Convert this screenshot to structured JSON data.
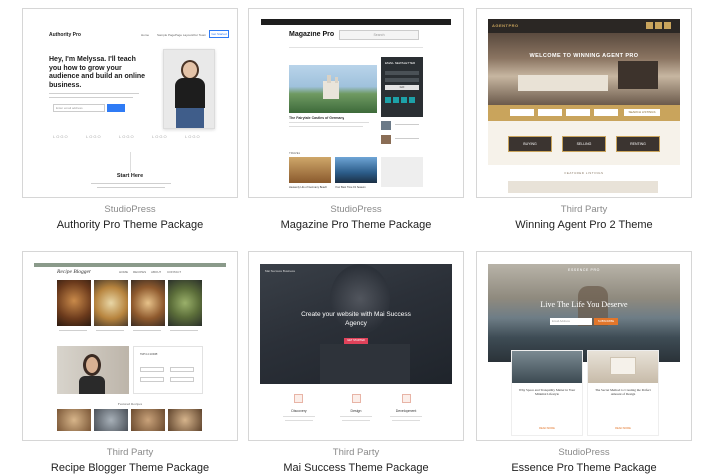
{
  "themes": [
    {
      "vendor": "StudioPress",
      "name": "Authority Pro Theme Package",
      "preview": {
        "logo": "Authority Pro",
        "nav": [
          "Home",
          "Sample Page",
          "Page Layouts",
          "Our Team"
        ],
        "nav_button": "Get Started",
        "headline": "Hey, I'm Melyssa. I'll teach you how to grow your audience and build an online business.",
        "email_placeholder": "Enter email address",
        "footer_heading": "Start Here",
        "logos": [
          "LOGO",
          "LOGO",
          "LOGO",
          "LOGO",
          "LOGO"
        ]
      }
    },
    {
      "vendor": "StudioPress",
      "name": "Magazine Pro Theme Package",
      "preview": {
        "logo": "Magazine Pro",
        "search_placeholder": "Search",
        "featured_caption": "The Fairytale Castles of Germany",
        "sidebar_heading": "EMAIL NEWSLETTER",
        "sidebar_button": "GO",
        "travel_label": "TRAVEL",
        "caption_left": "Heavenly Life of Germany Beach",
        "caption_right": "Your Best Time Fit Season"
      }
    },
    {
      "vendor": "Third Party",
      "name": "Winning Agent Pro 2 Theme",
      "preview": {
        "logo": "AGENTPRO",
        "hero_title": "WELCOME TO WINNING AGENT PRO",
        "search_button": "SEARCH LISTINGS",
        "tiles": [
          "BUYING",
          "SELLING",
          "RENTING"
        ],
        "footer_label": "FEATURED LISTINGS"
      }
    },
    {
      "vendor": "Third Party",
      "name": "Recipe Blogger Theme Package",
      "preview": {
        "logo": "Recipe Blogger",
        "nav": [
          "HOME",
          "RECIPES",
          "ABOUT",
          "CONTACT"
        ],
        "widget_heading": "WELCOME",
        "featured_label": "Featured Recipes"
      }
    },
    {
      "vendor": "Third Party",
      "name": "Mai Success Theme Package",
      "preview": {
        "logo": "Mai Success Business",
        "hero_title": "Create your website with Mai Success Agency",
        "hero_button": "GET STARTED",
        "features": [
          "Discovery",
          "Design",
          "Development"
        ]
      }
    },
    {
      "vendor": "StudioPress",
      "name": "Essence Pro Theme Package",
      "preview": {
        "logo": "ESSENCE PRO",
        "hero_title": "Live The Life You Deserve",
        "email_placeholder": "Email Address",
        "subscribe_button": "SUBSCRIBE",
        "post_left": "Why Space and Tranquility Matter in Your Minimal Lifestyle",
        "post_right": "The Secret Method to Creating the Perfect Amount of Design",
        "read_more": "READ MORE"
      }
    }
  ],
  "colors": {
    "card_border": "#d6d6d6",
    "vendor_text": "#8a8a8a",
    "title_text": "#222222",
    "authority_accent": "#2f7bf5",
    "winning_gold": "#c9a45c",
    "mai_accent": "#e0425a",
    "essence_orange": "#e2762b"
  }
}
